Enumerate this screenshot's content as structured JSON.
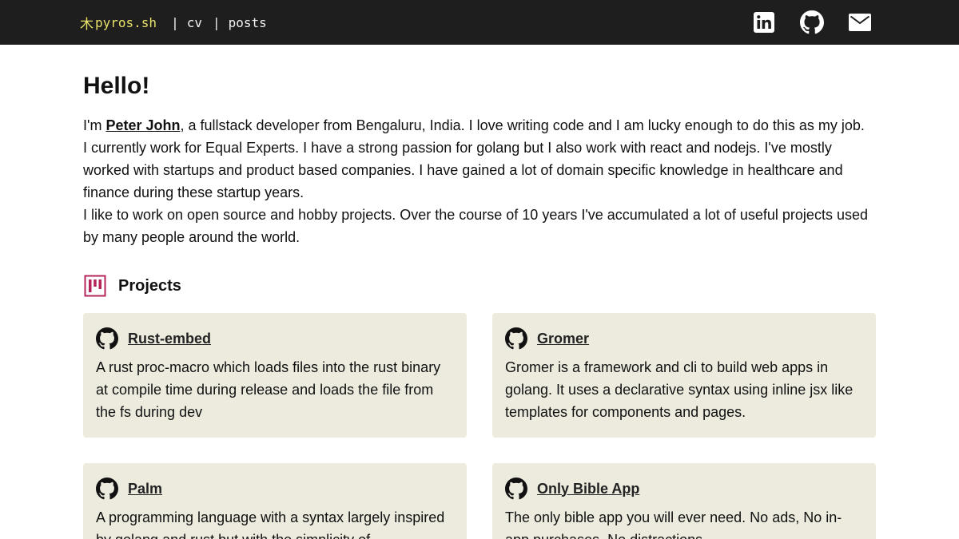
{
  "nav": {
    "brand_glyph": "木",
    "brand_name": "pyros.sh",
    "separator": "|",
    "links": [
      "cv",
      "posts"
    ]
  },
  "social": [
    "linkedin-icon",
    "github-icon",
    "mail-icon"
  ],
  "hero": {
    "greeting": "Hello!",
    "intro_prefix": "I'm ",
    "name": "Peter John",
    "intro_line1_rest": ", a fullstack developer from Bengaluru, India. I love writing code and I am lucky enough to do this as my job.",
    "intro_para2": "I currently work for Equal Experts. I have a strong passion for golang but I also work with react and nodejs. I've mostly worked with startups and product based companies. I have gained a lot of domain specific knowledge in healthcare and finance during these startup years.",
    "intro_para3": "I like to work on open source and hobby projects. Over the course of 10 years I've accumulated a lot of useful projects used by many people around the world."
  },
  "projects": {
    "title": "Projects",
    "items": [
      {
        "name": "Rust-embed",
        "description": "A rust proc-macro which loads files into the rust binary at compile time during release and loads the file from the fs during dev"
      },
      {
        "name": "Gromer",
        "description": "Gromer is a framework and cli to build web apps in golang. It uses a declarative syntax using inline jsx like templates for components and pages."
      },
      {
        "name": "Palm",
        "description": "A programming language with a syntax largely inspired by golang and rust but with the simplicity of"
      },
      {
        "name": "Only Bible App",
        "description": "The only bible app you will ever need. No ads, No in-app purchases, No distractions."
      }
    ]
  },
  "colors": {
    "topbar": "#1e1e1e",
    "brand": "#e9e26a",
    "card": "#edebde",
    "projects_icon": "#b5245a"
  }
}
